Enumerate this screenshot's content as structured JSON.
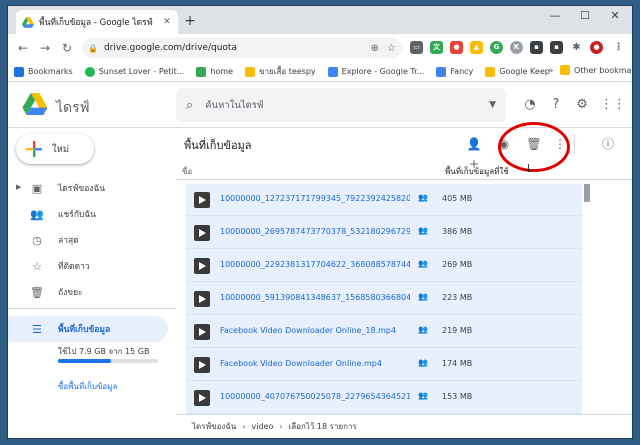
{
  "browser": {
    "tab_title": "พื้นที่เก็บข้อมูล - Google ไดรฟ์",
    "url": "drive.google.com/drive/quota",
    "window_controls": {
      "minimize": "—",
      "maximize": "☐",
      "close": "✕"
    },
    "bookmarks": [
      {
        "label": "Bookmarks",
        "color": "#1a73e8"
      },
      {
        "label": "Sunset Lover - Petit...",
        "color": "#1db954"
      },
      {
        "label": "home",
        "color": "#34a853"
      },
      {
        "label": "ขายเสื้อ teespy",
        "color": "#fbbc04"
      },
      {
        "label": "Explore - Google Tr...",
        "color": "#4285f4"
      },
      {
        "label": "Fancy",
        "color": "#4285f4"
      },
      {
        "label": "Google Keep",
        "color": "#fbbc04"
      }
    ],
    "other_bookmarks": "Other bookmarks"
  },
  "drive": {
    "app_name": "ไดรฟ์",
    "search_placeholder": "ค้นหาในไดรฟ์",
    "new_button": "ใหม่",
    "nav": [
      {
        "label": "ไดรฟ์ของฉัน",
        "icon": "my-drive-icon",
        "active": false
      },
      {
        "label": "แชร์กับฉัน",
        "icon": "people-icon",
        "active": false
      },
      {
        "label": "ล่าสุด",
        "icon": "clock-icon",
        "active": false
      },
      {
        "label": "ที่ติดดาว",
        "icon": "star-icon",
        "active": false
      },
      {
        "label": "ถังขยะ",
        "icon": "trash-icon",
        "active": false
      },
      {
        "label": "พื้นที่เก็บข้อมูล",
        "icon": "storage-icon",
        "active": true
      }
    ],
    "quota_text": "ใช้ไป 7.9 GB จาก 15 GB",
    "quota_used_fraction": 0.53,
    "buy_storage": "ซื้อพื้นที่เก็บข้อมูล",
    "page_title": "พื้นที่เก็บข้อมูล",
    "col_name": "ชื่อ",
    "col_storage": "พื้นที่เก็บข้อมูลที่ใช้",
    "files": [
      {
        "name": "10000000_127237171799345_7922392425820...",
        "size": "405 MB",
        "shared": true
      },
      {
        "name": "10000000_2695787473770378_532180296729...",
        "size": "386 MB",
        "shared": true
      },
      {
        "name": "10000000_2292381317704622_368088578744...",
        "size": "269 MB",
        "shared": true
      },
      {
        "name": "10000000_591390841348637_1568580366804...",
        "size": "223 MB",
        "shared": true
      },
      {
        "name": "Facebook Video Downloader Online_18.mp4",
        "size": "219 MB",
        "shared": true
      },
      {
        "name": "Facebook Video Downloader Online.mp4",
        "size": "174 MB",
        "shared": true
      },
      {
        "name": "10000000_407076750025078_2279654364521...",
        "size": "153 MB",
        "shared": true
      }
    ],
    "breadcrumb": [
      "ไดรฟ์ของฉัน",
      "video",
      "เลือกไว้ 18 รายการ"
    ],
    "highlight_color": "#e00000"
  }
}
